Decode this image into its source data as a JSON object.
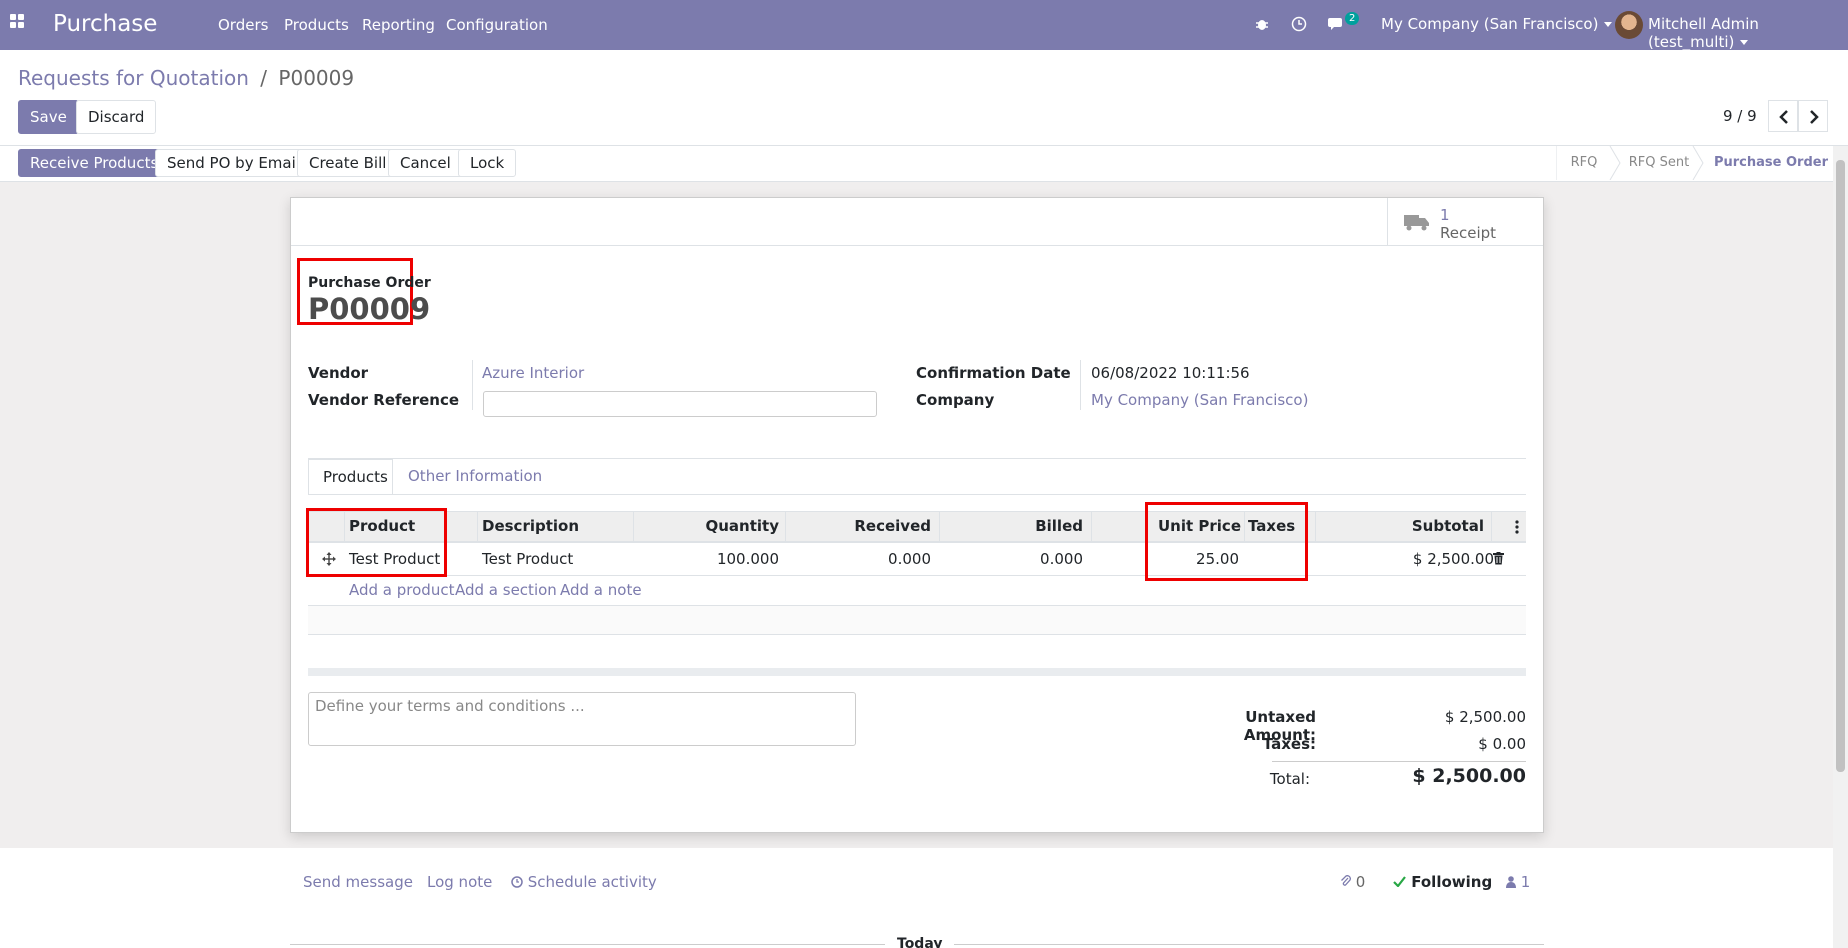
{
  "nav": {
    "app": "Purchase",
    "menu": [
      "Orders",
      "Products",
      "Reporting",
      "Configuration"
    ],
    "messages_count": "2",
    "company": "My Company (San Francisco)",
    "user": "Mitchell Admin (test_multi)"
  },
  "breadcrumb": {
    "parent": "Requests for Quotation",
    "sep": "/",
    "current": "P00009"
  },
  "actions": {
    "save": "Save",
    "discard": "Discard"
  },
  "pager": {
    "text": "9 / 9"
  },
  "header_buttons": [
    "Receive Products",
    "Send PO by Email",
    "Create Bill",
    "Cancel",
    "Lock"
  ],
  "stages": {
    "rfq": "RFQ",
    "rfq_sent": "RFQ Sent",
    "purchase_order": "Purchase Order",
    "active": "Purchase Order"
  },
  "smart_button": {
    "count": "1",
    "label": "Receipt"
  },
  "order": {
    "label": "Purchase Order",
    "name": "P00009",
    "vendor_label": "Vendor",
    "vendor": "Azure Interior",
    "vendor_ref_label": "Vendor Reference",
    "vendor_ref": "",
    "confirmation_label": "Confirmation Date",
    "confirmation": "06/08/2022 10:11:56",
    "company_label": "Company",
    "company": "My Company (San Francisco)"
  },
  "tabs": [
    "Products",
    "Other Information"
  ],
  "lines": {
    "headers": {
      "product": "Product",
      "description": "Description",
      "quantity": "Quantity",
      "received": "Received",
      "billed": "Billed",
      "unit_price": "Unit Price",
      "taxes": "Taxes",
      "subtotal": "Subtotal"
    },
    "rows": [
      {
        "product": "Test Product",
        "description": "Test Product",
        "quantity": "100.000",
        "received": "0.000",
        "billed": "0.000",
        "unit_price": "25.00",
        "taxes": "",
        "subtotal": "$ 2,500.00"
      }
    ],
    "add_product": "Add a product",
    "add_section": "Add a section",
    "add_note": "Add a note"
  },
  "notes": {
    "placeholder": "Define your terms and conditions ..."
  },
  "totals": {
    "untaxed_label": "Untaxed Amount:",
    "untaxed": "$ 2,500.00",
    "taxes_label": "Taxes:",
    "taxes": "$ 0.00",
    "total_label": "Total:",
    "total": "$ 2,500.00"
  },
  "chatter": {
    "send_message": "Send message",
    "log_note": "Log note",
    "schedule_activity": "Schedule activity",
    "attachments": "0",
    "following": "Following",
    "followers": "1",
    "today": "Today"
  }
}
